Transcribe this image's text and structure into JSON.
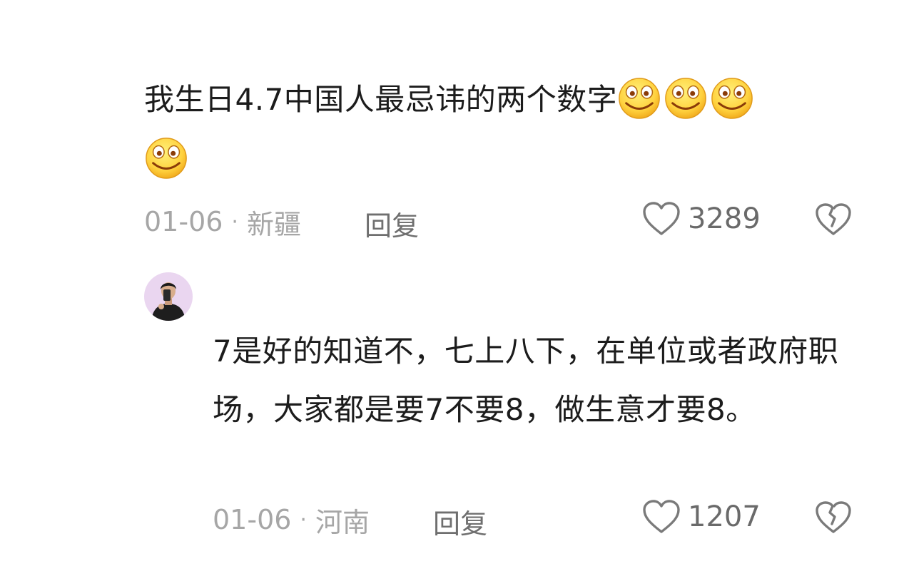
{
  "comments": [
    {
      "text": "我生日4.7中国人最忌讳的两个数字",
      "emoji": "smile-emoji",
      "emoji_count": 4,
      "date": "01-06",
      "separator": "·",
      "location": "新疆",
      "reply_label": "回复",
      "like_count": "3289"
    },
    {
      "text": "7是好的知道不，七上八下，在单位或者政府职场，大家都是要7不要8，做生意才要8。",
      "date": "01-06",
      "separator": "·",
      "location": "河南",
      "reply_label": "回复",
      "like_count": "1207"
    }
  ],
  "icons": {
    "like": "heart-outline-icon",
    "dislike": "broken-heart-icon",
    "avatar": "user-avatar"
  },
  "colors": {
    "text": "#1c1c1c",
    "meta": "#a6a6a6",
    "action": "#6f6f6f",
    "emoji_face": "#ffd23f"
  }
}
